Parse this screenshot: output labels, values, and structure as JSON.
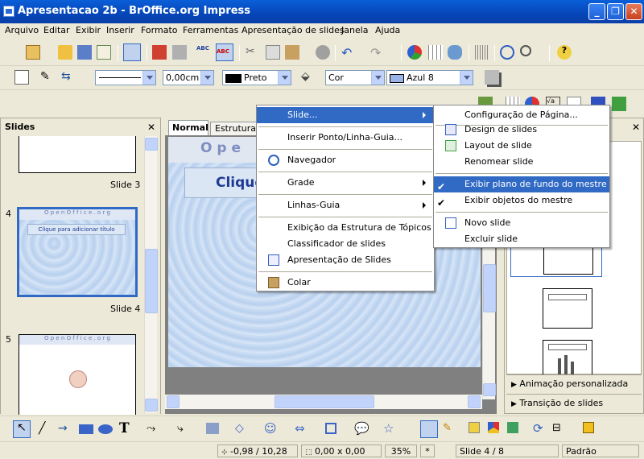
{
  "window": {
    "title": "Apresentacao 2b - BrOffice.org Impress",
    "min": "_",
    "max": "❐",
    "close": "✕"
  },
  "menubar": [
    "Arquivo",
    "Editar",
    "Exibir",
    "Inserir",
    "Formato",
    "Ferramentas",
    "Apresentação de slides",
    "Janela",
    "Ajuda"
  ],
  "line_toolbar": {
    "line_style": "",
    "width": "0,00cm",
    "line_color": "Preto",
    "fill_type": "Cor",
    "fill_color": "Azul 8"
  },
  "slides_panel": {
    "title": "Slides",
    "close": "✕",
    "slides": [
      {
        "num": "",
        "label": "Slide 3"
      },
      {
        "num": "4",
        "label": "Slide 4",
        "text": "Clique para adicionar título",
        "brand": "O p e n   O f f i c e . o r g"
      },
      {
        "num": "5",
        "label": "",
        "brand": "O p e n   O f f i c e . o r g"
      }
    ]
  },
  "tabs": {
    "normal": "Normal",
    "outline": "Estrutura"
  },
  "editor": {
    "title_text": "Clique",
    "brand": "O p e"
  },
  "context_menu": {
    "items": [
      "Slide...",
      "Inserir Ponto/Linha-Guia...",
      "Navegador",
      "Grade",
      "Linhas-Guia",
      "Exibição da Estrutura de Tópicos",
      "Classificador de slides",
      "Apresentação de Slides",
      "Colar"
    ]
  },
  "submenu": {
    "items": [
      "Configuração de Página...",
      "Design de slides",
      "Layout de slide",
      "Renomear slide",
      "Exibir plano de fundo do mestre",
      "Exibir objetos do mestre",
      "Novo slide",
      "Excluir slide"
    ],
    "checked": [
      "Exibir plano de fundo do mestre",
      "Exibir objetos do mestre"
    ]
  },
  "task_panel": {
    "animation": "Animação personalizada",
    "transition": "Transição de slides",
    "close": "✕"
  },
  "statusbar": {
    "position": "-0,98 / 10,28",
    "size": "0,00 x 0,00",
    "zoom": "35%",
    "modified": "*",
    "slide": "Slide 4 / 8",
    "layout": "Padrão"
  },
  "colors": {
    "titlebar": "#0a5fd8",
    "highlight": "#316ac5",
    "brand_text": "#1f3a93"
  }
}
